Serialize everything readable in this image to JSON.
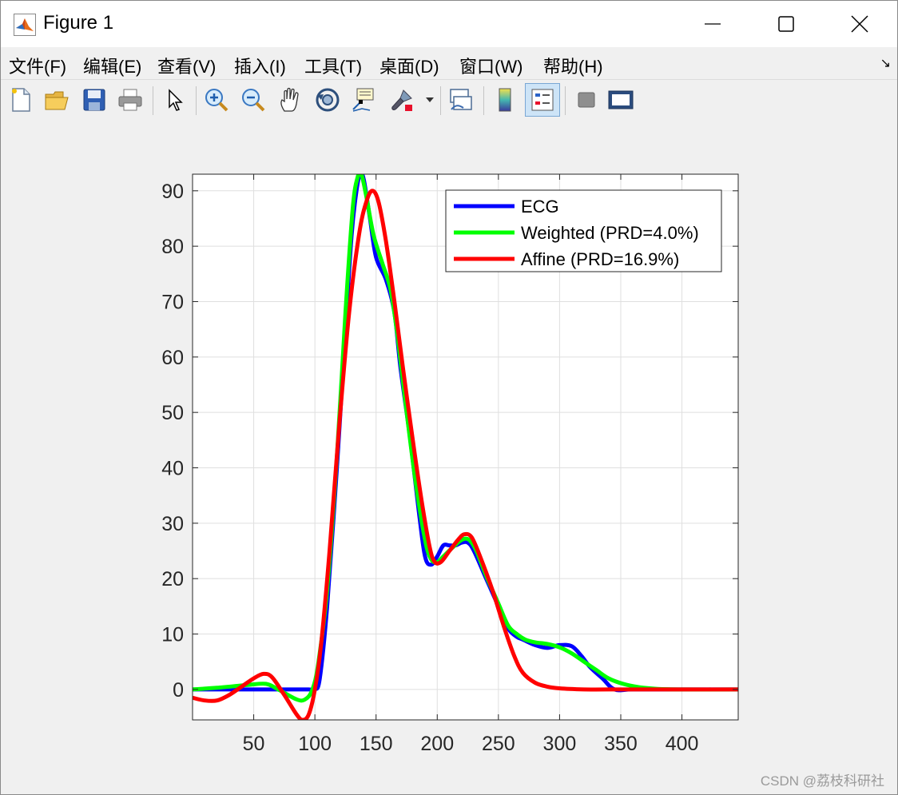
{
  "window": {
    "title": "Figure 1"
  },
  "menu": {
    "items": [
      "文件(F)",
      "编辑(E)",
      "查看(V)",
      "插入(I)",
      "工具(T)",
      "桌面(D)",
      "窗口(W)",
      "帮助(H)"
    ]
  },
  "toolbar": {
    "icons": [
      "new-figure-icon",
      "open-file-icon",
      "save-icon",
      "print-icon",
      "pointer-icon",
      "zoom-in-icon",
      "zoom-out-icon",
      "pan-hand-icon",
      "rotate-3d-icon",
      "data-cursor-icon",
      "brush-icon",
      "brush-dropdown-icon",
      "link-plot-icon",
      "colorbar-icon",
      "legend-icon",
      "hide-plot-tools-icon",
      "show-plot-tools-icon"
    ]
  },
  "watermark": "CSDN @荔枝科研社",
  "colors": {
    "ecg": "#0000ff",
    "weighted": "#00ff00",
    "affine": "#ff0000"
  },
  "chart_data": {
    "type": "line",
    "title": "",
    "xlabel": "",
    "ylabel": "",
    "xlim": [
      0,
      446
    ],
    "ylim": [
      -5.5,
      93
    ],
    "xticks": [
      50,
      100,
      150,
      200,
      250,
      300,
      350,
      400
    ],
    "yticks": [
      0,
      10,
      20,
      30,
      40,
      50,
      60,
      70,
      80,
      90
    ],
    "grid": true,
    "legend_position": "top-right",
    "series": [
      {
        "name": "ECG",
        "color": "#0000ff",
        "points": [
          [
            0,
            0
          ],
          [
            40,
            0
          ],
          [
            60,
            0
          ],
          [
            80,
            0
          ],
          [
            95,
            0
          ],
          [
            100,
            0
          ],
          [
            104,
            2
          ],
          [
            110,
            15
          ],
          [
            118,
            40
          ],
          [
            125,
            65
          ],
          [
            130,
            82
          ],
          [
            134,
            90
          ],
          [
            137,
            93
          ],
          [
            140,
            92
          ],
          [
            145,
            85
          ],
          [
            150,
            78
          ],
          [
            158,
            74
          ],
          [
            165,
            68
          ],
          [
            170,
            58
          ],
          [
            178,
            45
          ],
          [
            185,
            32
          ],
          [
            190,
            24
          ],
          [
            195,
            22.5
          ],
          [
            200,
            24
          ],
          [
            205,
            26
          ],
          [
            210,
            26
          ],
          [
            215,
            26
          ],
          [
            220,
            26.5
          ],
          [
            225,
            26.5
          ],
          [
            230,
            25
          ],
          [
            240,
            20
          ],
          [
            250,
            15
          ],
          [
            258,
            11
          ],
          [
            265,
            9.5
          ],
          [
            270,
            9
          ],
          [
            280,
            8
          ],
          [
            290,
            7.5
          ],
          [
            300,
            8
          ],
          [
            310,
            7.8
          ],
          [
            318,
            6
          ],
          [
            325,
            4
          ],
          [
            335,
            2
          ],
          [
            345,
            0
          ],
          [
            360,
            0
          ],
          [
            400,
            0
          ],
          [
            446,
            0
          ]
        ]
      },
      {
        "name": "Weighted (PRD=4.0%)",
        "color": "#00ff00",
        "points": [
          [
            0,
            0
          ],
          [
            20,
            0.3
          ],
          [
            45,
            0.8
          ],
          [
            60,
            1
          ],
          [
            70,
            0
          ],
          [
            85,
            -1.8
          ],
          [
            92,
            -1.8
          ],
          [
            98,
            0
          ],
          [
            103,
            5
          ],
          [
            110,
            18
          ],
          [
            118,
            42
          ],
          [
            125,
            68
          ],
          [
            131,
            87
          ],
          [
            135,
            92.5
          ],
          [
            138,
            93
          ],
          [
            142,
            89
          ],
          [
            148,
            82
          ],
          [
            155,
            77
          ],
          [
            162,
            72
          ],
          [
            168,
            63
          ],
          [
            175,
            50
          ],
          [
            182,
            38
          ],
          [
            190,
            27
          ],
          [
            195,
            23.5
          ],
          [
            200,
            23
          ],
          [
            205,
            24
          ],
          [
            212,
            25.5
          ],
          [
            220,
            27
          ],
          [
            226,
            27
          ],
          [
            232,
            25
          ],
          [
            240,
            20.5
          ],
          [
            250,
            15.5
          ],
          [
            258,
            11.5
          ],
          [
            265,
            10
          ],
          [
            272,
            9
          ],
          [
            280,
            8.5
          ],
          [
            290,
            8.2
          ],
          [
            300,
            7.6
          ],
          [
            310,
            6.5
          ],
          [
            320,
            5
          ],
          [
            330,
            3.5
          ],
          [
            340,
            2
          ],
          [
            352,
            1
          ],
          [
            365,
            0.4
          ],
          [
            380,
            0.1
          ],
          [
            400,
            0
          ],
          [
            446,
            0
          ]
        ]
      },
      {
        "name": "Affine (PRD=16.9%)",
        "color": "#ff0000",
        "points": [
          [
            0,
            -1.5
          ],
          [
            10,
            -2
          ],
          [
            20,
            -2
          ],
          [
            30,
            -1
          ],
          [
            40,
            0.5
          ],
          [
            50,
            2
          ],
          [
            58,
            2.8
          ],
          [
            65,
            2.2
          ],
          [
            75,
            -1
          ],
          [
            85,
            -4.5
          ],
          [
            90,
            -5.5
          ],
          [
            95,
            -4.5
          ],
          [
            100,
            0
          ],
          [
            105,
            8
          ],
          [
            112,
            25
          ],
          [
            120,
            48
          ],
          [
            128,
            68
          ],
          [
            136,
            82
          ],
          [
            142,
            88
          ],
          [
            147,
            90
          ],
          [
            152,
            88
          ],
          [
            158,
            81
          ],
          [
            165,
            70
          ],
          [
            172,
            58
          ],
          [
            180,
            45
          ],
          [
            188,
            33
          ],
          [
            194,
            25.5
          ],
          [
            198,
            23
          ],
          [
            203,
            23
          ],
          [
            210,
            25
          ],
          [
            217,
            27
          ],
          [
            222,
            28
          ],
          [
            228,
            27.5
          ],
          [
            235,
            24
          ],
          [
            245,
            18
          ],
          [
            255,
            11
          ],
          [
            263,
            6
          ],
          [
            270,
            3
          ],
          [
            280,
            1.2
          ],
          [
            290,
            0.5
          ],
          [
            300,
            0.2
          ],
          [
            320,
            0
          ],
          [
            340,
            0
          ],
          [
            400,
            0
          ],
          [
            446,
            0
          ]
        ]
      }
    ]
  }
}
